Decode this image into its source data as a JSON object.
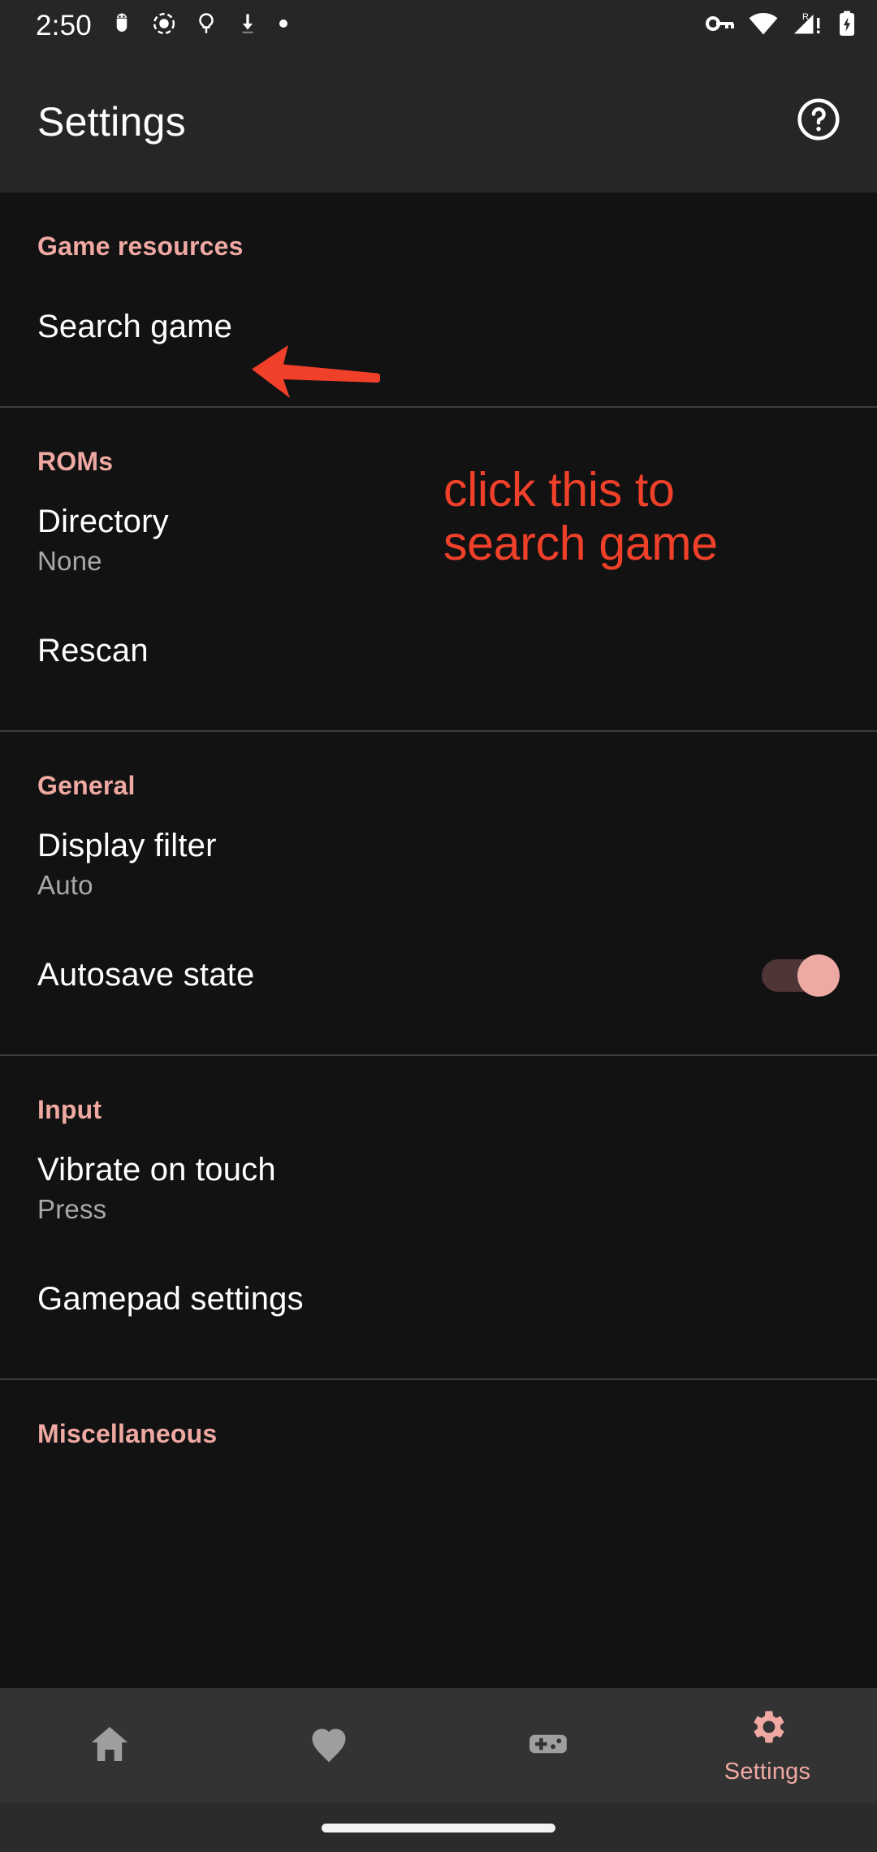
{
  "status_bar": {
    "clock": "2:50",
    "left_icons": [
      "android-debug-icon",
      "screen-record-icon",
      "flashlight-icon",
      "download-icon",
      "dot-indicator-icon"
    ],
    "right_icons": [
      "vpn-key-icon",
      "wifi-icon",
      "cellular-signal-roaming-icon",
      "battery-charging-icon"
    ],
    "roaming_label": "R",
    "signal_alert_label": "!"
  },
  "app_bar": {
    "title": "Settings",
    "help_icon": "help-circle-icon"
  },
  "sections": [
    {
      "header": "Game resources",
      "rows": [
        {
          "title": "Search game",
          "subtitle": "",
          "control": "none"
        }
      ]
    },
    {
      "header": "ROMs",
      "rows": [
        {
          "title": "Directory",
          "subtitle": "None",
          "control": "none"
        },
        {
          "title": "Rescan",
          "subtitle": "",
          "control": "none"
        }
      ]
    },
    {
      "header": "General",
      "rows": [
        {
          "title": "Display filter",
          "subtitle": "Auto",
          "control": "none"
        },
        {
          "title": "Autosave state",
          "subtitle": "",
          "control": "switch",
          "switch_on": true
        }
      ]
    },
    {
      "header": "Input",
      "rows": [
        {
          "title": "Vibrate on touch",
          "subtitle": "Press",
          "control": "none"
        },
        {
          "title": "Gamepad settings",
          "subtitle": "",
          "control": "none"
        }
      ]
    },
    {
      "header": "Miscellaneous",
      "rows": []
    }
  ],
  "bottom_nav": {
    "items": [
      {
        "label": "",
        "icon": "home-icon",
        "selected": false
      },
      {
        "label": "",
        "icon": "heart-icon",
        "selected": false
      },
      {
        "label": "",
        "icon": "gamepad-icon",
        "selected": false
      },
      {
        "label": "Settings",
        "icon": "gear-icon",
        "selected": true
      }
    ]
  },
  "annotation": {
    "text": "click this to\nsearch game",
    "arrow": "left-pointing-arrow",
    "color": "#f0402a"
  },
  "colors": {
    "accent_pink": "#efa9a2",
    "annotation_red": "#f0402a",
    "background": "#121212",
    "bar_background": "#262626",
    "nav_background": "#333333",
    "divider": "#3b3b3b",
    "switch_track": "#4d3635",
    "switch_thumb": "#eda9a4",
    "subtitle_gray": "#a8a8a8",
    "nav_icon_gray": "#9e9e9e"
  }
}
